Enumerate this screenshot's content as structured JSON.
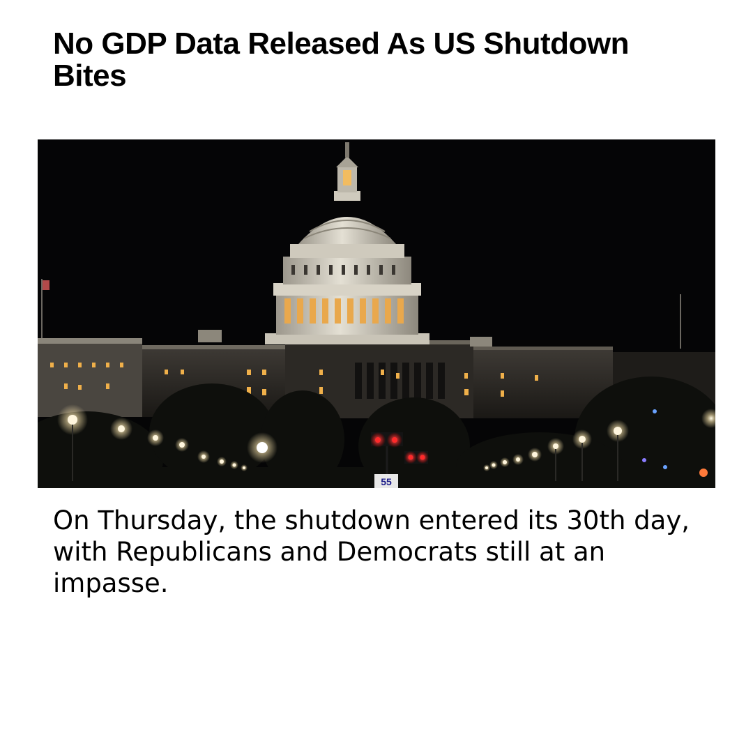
{
  "article": {
    "headline": "No GDP Data Released As US Shutdown Bites",
    "caption": "On Thursday, the shutdown entered its 30th day, with Republicans and Democrats still at an impasse."
  },
  "photo": {
    "subject": "capitol-building-at-night",
    "sign_text": "55"
  },
  "colors": {
    "background": "#ffffff",
    "text": "#000000",
    "sky": "#050506",
    "dome": "#d9d4c6",
    "window_light": "#f0b04a",
    "street_light": "#fff6de",
    "signal_red": "#ff2a2a"
  }
}
